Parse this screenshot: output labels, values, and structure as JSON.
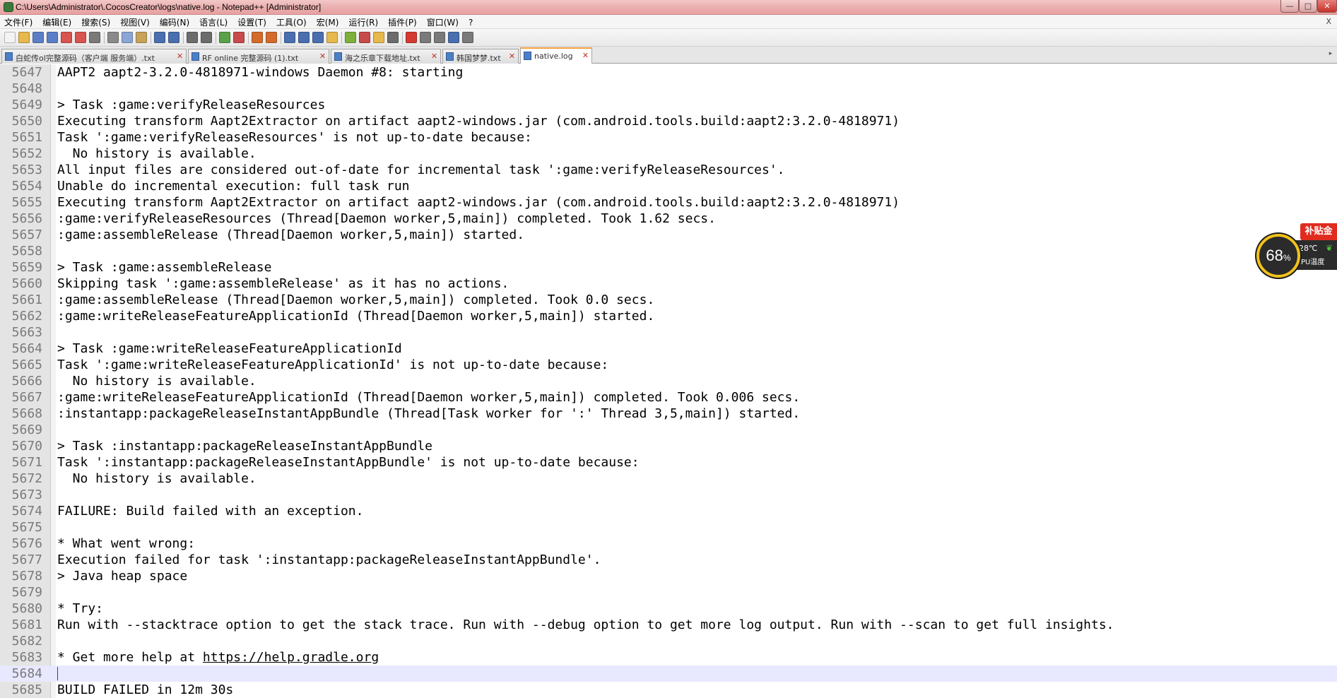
{
  "window": {
    "title": "C:\\Users\\Administrator\\.CocosCreator\\logs\\native.log - Notepad++ [Administrator]",
    "controls": {
      "minimize": "—",
      "maximize": "□",
      "close": "✕"
    }
  },
  "menu": {
    "items": [
      "文件(F)",
      "编辑(E)",
      "搜索(S)",
      "视图(V)",
      "编码(N)",
      "语言(L)",
      "设置(T)",
      "工具(O)",
      "宏(M)",
      "运行(R)",
      "插件(P)",
      "窗口(W)",
      "?"
    ],
    "right_label": "X"
  },
  "toolbar": {
    "buttons": [
      {
        "name": "new-file-icon",
        "color": "#f4f4f4"
      },
      {
        "name": "open-file-icon",
        "color": "#e7b84b"
      },
      {
        "name": "save-icon",
        "color": "#5b7fc7"
      },
      {
        "name": "save-all-icon",
        "color": "#5b7fc7"
      },
      {
        "name": "close-icon",
        "color": "#d9534f"
      },
      {
        "name": "close-all-icon",
        "color": "#d9534f"
      },
      {
        "name": "print-icon",
        "color": "#7a7a7a"
      },
      {
        "name": "cut-icon",
        "color": "#8a8a8a"
      },
      {
        "name": "copy-icon",
        "color": "#8aa6d6"
      },
      {
        "name": "paste-icon",
        "color": "#c9a25a"
      },
      {
        "name": "undo-icon",
        "color": "#4a6fb0"
      },
      {
        "name": "redo-icon",
        "color": "#4a6fb0"
      },
      {
        "name": "find-icon",
        "color": "#6c6c6c"
      },
      {
        "name": "replace-icon",
        "color": "#6c6c6c"
      },
      {
        "name": "zoom-in-icon",
        "color": "#5aa14a"
      },
      {
        "name": "zoom-out-icon",
        "color": "#c94a4a"
      },
      {
        "name": "sync-v-icon",
        "color": "#d46b2a"
      },
      {
        "name": "sync-h-icon",
        "color": "#d46b2a"
      },
      {
        "name": "word-wrap-icon",
        "color": "#4a6fb0"
      },
      {
        "name": "show-all-chars-icon",
        "color": "#4a6fb0"
      },
      {
        "name": "indent-guide-icon",
        "color": "#4a6fb0"
      },
      {
        "name": "user-lang-icon",
        "color": "#e7b84b"
      },
      {
        "name": "doc-map-icon",
        "color": "#7fb03c"
      },
      {
        "name": "function-list-icon",
        "color": "#c94a4a"
      },
      {
        "name": "folder-workspace-icon",
        "color": "#e7b84b"
      },
      {
        "name": "monitor-icon",
        "color": "#6c6c6c"
      },
      {
        "name": "record-macro-icon",
        "color": "#d43a2f"
      },
      {
        "name": "stop-macro-icon",
        "color": "#7a7a7a"
      },
      {
        "name": "play-macro-icon",
        "color": "#7a7a7a"
      },
      {
        "name": "play-multiple-icon",
        "color": "#4a6fb0"
      },
      {
        "name": "save-macro-icon",
        "color": "#7a7a7a"
      }
    ]
  },
  "tabs": [
    {
      "label": "白蛇传ol完整源码（客户端 服务端）.txt",
      "active": false
    },
    {
      "label": "RF online 完整源码 (1).txt",
      "active": false
    },
    {
      "label": "海之乐章下载地址.txt",
      "active": false
    },
    {
      "label": "韩国梦梦.txt",
      "active": false
    },
    {
      "label": "native.log",
      "active": true
    }
  ],
  "tab_close_glyph": "✕",
  "tab_scroll_glyph": "▸",
  "editor": {
    "current_line": 5684,
    "lines": [
      {
        "n": "5647",
        "text": "AAPT2 aapt2-3.2.0-4818971-windows Daemon #8: starting"
      },
      {
        "n": "5648",
        "text": ""
      },
      {
        "n": "5649",
        "text": "> Task :game:verifyReleaseResources"
      },
      {
        "n": "5650",
        "text": "Executing transform Aapt2Extractor on artifact aapt2-windows.jar (com.android.tools.build:aapt2:3.2.0-4818971)"
      },
      {
        "n": "5651",
        "text": "Task ':game:verifyReleaseResources' is not up-to-date because:"
      },
      {
        "n": "5652",
        "text": "  No history is available."
      },
      {
        "n": "5653",
        "text": "All input files are considered out-of-date for incremental task ':game:verifyReleaseResources'."
      },
      {
        "n": "5654",
        "text": "Unable do incremental execution: full task run"
      },
      {
        "n": "5655",
        "text": "Executing transform Aapt2Extractor on artifact aapt2-windows.jar (com.android.tools.build:aapt2:3.2.0-4818971)"
      },
      {
        "n": "5656",
        "text": ":game:verifyReleaseResources (Thread[Daemon worker,5,main]) completed. Took 1.62 secs."
      },
      {
        "n": "5657",
        "text": ":game:assembleRelease (Thread[Daemon worker,5,main]) started."
      },
      {
        "n": "5658",
        "text": ""
      },
      {
        "n": "5659",
        "text": "> Task :game:assembleRelease"
      },
      {
        "n": "5660",
        "text": "Skipping task ':game:assembleRelease' as it has no actions."
      },
      {
        "n": "5661",
        "text": ":game:assembleRelease (Thread[Daemon worker,5,main]) completed. Took 0.0 secs."
      },
      {
        "n": "5662",
        "text": ":game:writeReleaseFeatureApplicationId (Thread[Daemon worker,5,main]) started."
      },
      {
        "n": "5663",
        "text": ""
      },
      {
        "n": "5664",
        "text": "> Task :game:writeReleaseFeatureApplicationId"
      },
      {
        "n": "5665",
        "text": "Task ':game:writeReleaseFeatureApplicationId' is not up-to-date because:"
      },
      {
        "n": "5666",
        "text": "  No history is available."
      },
      {
        "n": "5667",
        "text": ":game:writeReleaseFeatureApplicationId (Thread[Daemon worker,5,main]) completed. Took 0.006 secs."
      },
      {
        "n": "5668",
        "text": ":instantapp:packageReleaseInstantAppBundle (Thread[Task worker for ':' Thread 3,5,main]) started."
      },
      {
        "n": "5669",
        "text": ""
      },
      {
        "n": "5670",
        "text": "> Task :instantapp:packageReleaseInstantAppBundle"
      },
      {
        "n": "5671",
        "text": "Task ':instantapp:packageReleaseInstantAppBundle' is not up-to-date because:"
      },
      {
        "n": "5672",
        "text": "  No history is available."
      },
      {
        "n": "5673",
        "text": ""
      },
      {
        "n": "5674",
        "text": "FAILURE: Build failed with an exception."
      },
      {
        "n": "5675",
        "text": ""
      },
      {
        "n": "5676",
        "text": "* What went wrong:"
      },
      {
        "n": "5677",
        "text": "Execution failed for task ':instantapp:packageReleaseInstantAppBundle'."
      },
      {
        "n": "5678",
        "text": "> Java heap space"
      },
      {
        "n": "5679",
        "text": ""
      },
      {
        "n": "5680",
        "text": "* Try:"
      },
      {
        "n": "5681",
        "text": "Run with --stacktrace option to get the stack trace. Run with --debug option to get more log output. Run with --scan to get full insights."
      },
      {
        "n": "5682",
        "text": ""
      },
      {
        "n": "5683",
        "text": "* Get more help at ",
        "link": "https://help.gradle.org"
      },
      {
        "n": "5684",
        "text": ""
      },
      {
        "n": "5685",
        "text": "BUILD FAILED in 12m 30s"
      }
    ]
  },
  "cpu_widget": {
    "badge": "补贴金",
    "percent": "68",
    "percent_unit": "%",
    "temperature": "28℃",
    "temp_label": "CPU温度",
    "leaf_glyph": "❦",
    "gauge_color": "#f0c21a",
    "badge_color": "#e02b1f"
  }
}
